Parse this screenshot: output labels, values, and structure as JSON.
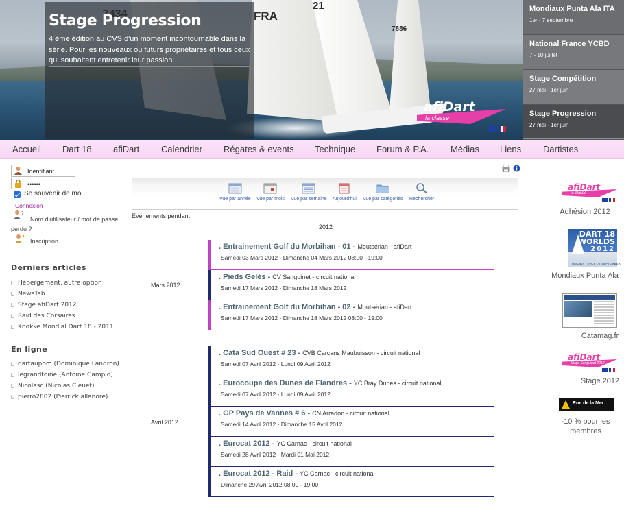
{
  "hero": {
    "title": "Stage Progression",
    "text": "4 ème édition au CVS d'un moment incontournable dans la série. Pour les nouveaux ou futurs propriétaires et tous ceux qui souhaitent entretenir leur passion.",
    "sail_numbers": [
      "7434",
      "FRA",
      "21",
      "7886"
    ],
    "logo_word": "afiDart",
    "logo_sub": "la classe",
    "events": [
      {
        "title": "Mondiaux Punta Ala ITA",
        "date": "1er - 7 septembre"
      },
      {
        "title": "National France YCBD",
        "date": "7 - 10 juillet"
      },
      {
        "title": "Stage Compétition",
        "date": "27 mai - 1er juin"
      },
      {
        "title": "Stage Progression",
        "date": "27 mai - 1er juin"
      }
    ]
  },
  "nav": {
    "items": [
      "Accueil",
      "Dart 18",
      "afiDart",
      "Calendrier",
      "Régates & events",
      "Technique",
      "Forum & P.A.",
      "Médias",
      "Liens",
      "Dartistes"
    ]
  },
  "login": {
    "username_value": "Identifiant",
    "password_value": "••••••",
    "remember_label": "Se souvenir de moi",
    "login_label": "Connexion",
    "forgot_label": "Nom d'utilisateur / mot de passe perdu ?",
    "register_label": "Inscription"
  },
  "latest_articles": {
    "heading": "Derniers articles",
    "items": [
      "Hébergement, autre option",
      "NewsTab",
      "Stage afiDart 2012",
      "Raid des Corsaires",
      "Knokke Mondial Dart 18 - 2011"
    ]
  },
  "online": {
    "heading": "En ligne",
    "items": [
      "dartaupom (Dominique Landron)",
      "legrandtoine (Antoine Camplo)",
      "Nicolasc (Nicolas Cleuet)",
      "pierro2802 (Pierrick allanore)"
    ]
  },
  "toolbar": {
    "buttons": [
      "Vue par année",
      "Vue par mois",
      "Vue par semaine",
      "Aujourd'hui",
      "Vue par catégories",
      "Rechercher"
    ]
  },
  "calendar": {
    "events_during": "Événements pendant",
    "year": "2012",
    "months": [
      {
        "label": "Mars 2012",
        "events": [
          {
            "title": "Entrainement Golf du Morbihan - 01",
            "location": "Moutsérian - afiDart",
            "date": "Samedi 03 Mars 2012 - Dimanche 04 Mars 2012 08:00 - 19:00",
            "color": "#c33fc3"
          },
          {
            "title": "Pieds Gelés",
            "location": "CV Sanguinet - circuit national",
            "date": "Samedi 17 Mars 2012 - Dimanche 18 Mars 2012",
            "color": "#1f2b6e"
          },
          {
            "title": "Entrainement Golf du Morbihan - 02",
            "location": "Moutsérian - afiDart",
            "date": "Samedi 17 Mars 2012 - Dimanche 18 Mars 2012 08:00 - 19:00",
            "color": "#c33fc3"
          }
        ]
      },
      {
        "label": "Avril 2012",
        "events": [
          {
            "title": "Cata Sud Ouest # 23",
            "location": "CVB Carcans Maubuisson - circuit national",
            "date": "Samedi 07 Avril 2012 - Lundi 09 Avril 2012",
            "color": "#1f2b6e"
          },
          {
            "title": "Eurocoupe des Dunes de Flandres",
            "location": "YC Bray Dunes - circuit national",
            "date": "Samedi 07 Avril 2012 - Lundi 09 Avril 2012",
            "color": "#1f2b6e"
          },
          {
            "title": "GP Pays de Vannes # 6",
            "location": "CN Arradon - circuit national",
            "date": "Samedi 14 Avril 2012 - Dimanche 15 Avril 2012",
            "color": "#1f2b6e"
          },
          {
            "title": "Eurocat 2012",
            "location": "YC Carnac - circuit national",
            "date": "Samedi 28 Avril 2012 - Mardi 01 Mai 2012",
            "color": "#1f2b6e"
          },
          {
            "title": "Eurocat 2012 - Raid",
            "location": "YC Carnac - circuit national",
            "date": "Dimanche 29 Avril 2012 08:00 - 19:00",
            "color": "#1f2b6e"
          }
        ]
      }
    ]
  },
  "right_sidebar": {
    "adhesion_caption": "Adhésion 2012",
    "adhesion_logo_word": "afiDart",
    "adhesion_logo_sub": "la classe",
    "worlds_title": "DART 18 WORLDS",
    "worlds_year": "2012",
    "worlds_sub": "TUSCANY - ITALY 1-7 SEPTEMBER",
    "worlds_caption": "Mondiaux Punta Ala",
    "catamag_caption": "Catamag.fr",
    "stage_caption": "Stage 2012",
    "stage_logo_word": "afiDart",
    "stage_logo_sub": "Stage Sanguinet 2012",
    "ruedelamer_text": "Rue de la Mer",
    "promo_caption": "-10 % pour les membres"
  },
  "colors": {
    "nav_bg": "#f7d6f4",
    "accent_pink": "#c33fc3",
    "accent_navy": "#1f2b6e",
    "event_title": "#4d6473",
    "link_purple": "#9b1f9b"
  }
}
